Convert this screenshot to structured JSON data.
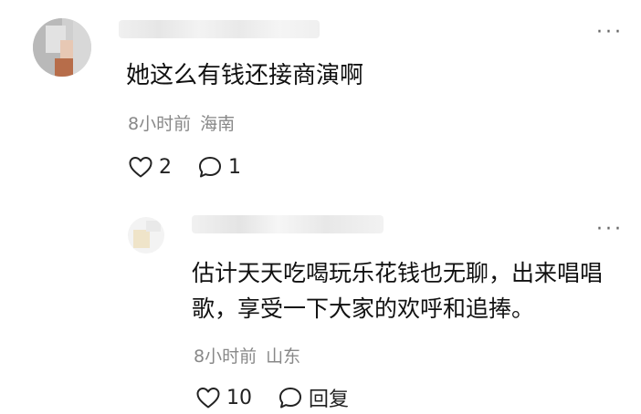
{
  "main_comment": {
    "text": "她这么有钱还接商演啊",
    "time": "8小时前",
    "location": "海南",
    "like_count": "2",
    "reply_count": "1"
  },
  "reply_comment": {
    "text": "估计天天吃喝玩乐花钱也无聊，出来唱唱歌，享受一下大家的欢呼和追捧。",
    "time": "8小时前",
    "location": "山东",
    "like_count": "10",
    "reply_label": "回复"
  },
  "icons": {
    "like": "heart-outline-icon",
    "comment": "speech-bubble-icon",
    "more": "ellipsis-icon"
  },
  "colors": {
    "text_primary": "#111111",
    "text_secondary": "#888888",
    "icon": "#222222"
  }
}
